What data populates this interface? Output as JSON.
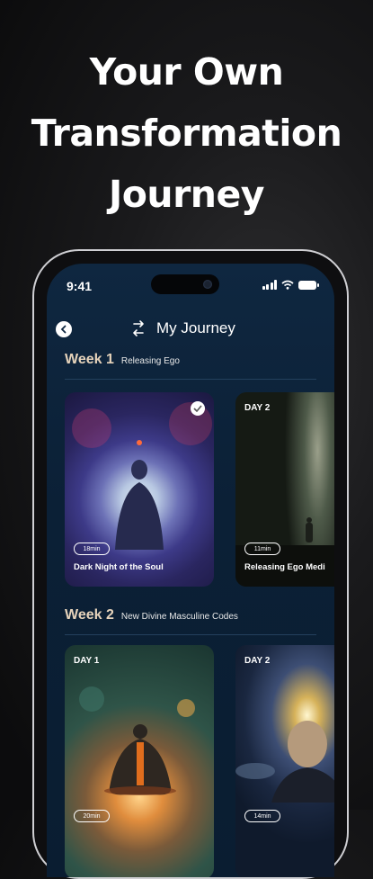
{
  "headline": {
    "line1": "Your Own",
    "line2": "Transformation",
    "line3": "Journey"
  },
  "status_bar": {
    "time": "9:41"
  },
  "nav": {
    "title": "My Journey"
  },
  "weeks": [
    {
      "label": "Week 1",
      "subtitle": "Releasing Ego",
      "cards": [
        {
          "day": "",
          "duration": "18min",
          "title": "Dark Night of the Soul",
          "completed": true
        },
        {
          "day": "DAY 2",
          "duration": "11min",
          "title": "Releasing Ego Medi",
          "completed": false
        }
      ]
    },
    {
      "label": "Week 2",
      "subtitle": "New Divine Masculine Codes",
      "cards": [
        {
          "day": "DAY 1",
          "duration": "20min",
          "title": "",
          "completed": false
        },
        {
          "day": "DAY 2",
          "duration": "14min",
          "title": "",
          "completed": false
        }
      ]
    }
  ],
  "icons": {
    "back": "chevron-left-icon",
    "journey": "route-icon",
    "check": "check-icon"
  },
  "colors": {
    "week_label": "#e6d3bb",
    "screen_bg": "#0f2740"
  }
}
